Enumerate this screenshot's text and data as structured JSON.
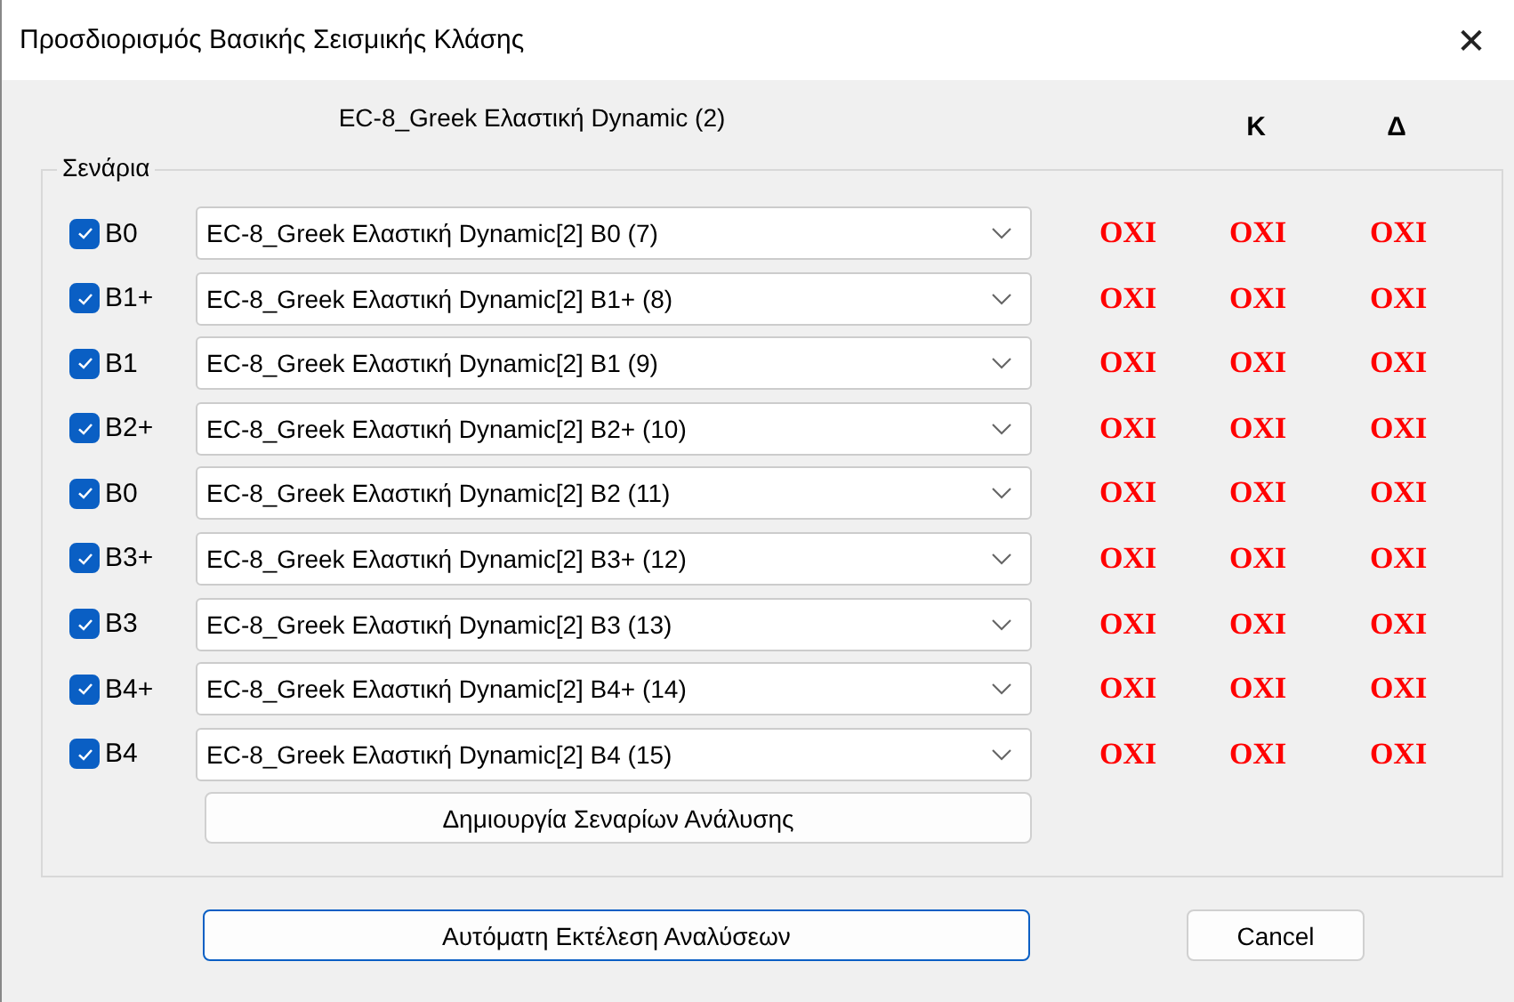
{
  "window": {
    "title": "Προσδιορισμός Βασικής Σεισμικής Κλάσης",
    "close": "✕"
  },
  "header": {
    "analysis": "EC-8_Greek Ελαστική Dynamic (2)",
    "columns": [
      "Κ",
      "Δ"
    ]
  },
  "group": {
    "title": "Σενάρια"
  },
  "scenarios": [
    {
      "checked": true,
      "label": "B0",
      "value": "EC-8_Greek Ελαστική Dynamic[2] B0 (7)",
      "results": [
        "OXI",
        "OXI",
        "OXI"
      ]
    },
    {
      "checked": true,
      "label": "B1+",
      "value": "EC-8_Greek Ελαστική Dynamic[2] B1+ (8)",
      "results": [
        "OXI",
        "OXI",
        "OXI"
      ]
    },
    {
      "checked": true,
      "label": "B1",
      "value": "EC-8_Greek Ελαστική Dynamic[2] B1 (9)",
      "results": [
        "OXI",
        "OXI",
        "OXI"
      ]
    },
    {
      "checked": true,
      "label": "B2+",
      "value": "EC-8_Greek Ελαστική Dynamic[2] B2+ (10)",
      "results": [
        "OXI",
        "OXI",
        "OXI"
      ]
    },
    {
      "checked": true,
      "label": "B0",
      "value": "EC-8_Greek Ελαστική Dynamic[2] B2 (11)",
      "results": [
        "OXI",
        "OXI",
        "OXI"
      ]
    },
    {
      "checked": true,
      "label": "B3+",
      "value": "EC-8_Greek Ελαστική Dynamic[2] B3+ (12)",
      "results": [
        "OXI",
        "OXI",
        "OXI"
      ]
    },
    {
      "checked": true,
      "label": "B3",
      "value": "EC-8_Greek Ελαστική Dynamic[2] B3 (13)",
      "results": [
        "OXI",
        "OXI",
        "OXI"
      ]
    },
    {
      "checked": true,
      "label": "B4+",
      "value": "EC-8_Greek Ελαστική Dynamic[2] B4+ (14)",
      "results": [
        "OXI",
        "OXI",
        "OXI"
      ]
    },
    {
      "checked": true,
      "label": "B4",
      "value": "EC-8_Greek Ελαστική Dynamic[2] B4 (15)",
      "results": [
        "OXI",
        "OXI",
        "OXI"
      ]
    }
  ],
  "create_button": "Δημιουργία Σεναρίων Ανάλυσης",
  "buttons": [
    {
      "label": "Αυτόματη Εκτέλεση Αναλύσεων",
      "default": true
    },
    {
      "label": "Cancel",
      "default": false
    }
  ]
}
